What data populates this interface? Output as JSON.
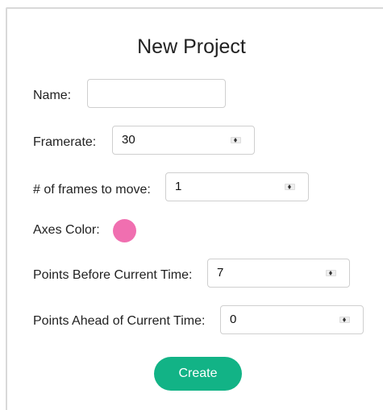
{
  "dialog": {
    "title": "New Project"
  },
  "fields": {
    "name": {
      "label": "Name:",
      "value": ""
    },
    "framerate": {
      "label": "Framerate:",
      "value": "30"
    },
    "frames_to_move": {
      "label": "# of frames to move:",
      "value": "1"
    },
    "axes_color": {
      "label": "Axes Color:",
      "color": "#f06fb0"
    },
    "points_before": {
      "label": "Points Before Current Time:",
      "value": "7"
    },
    "points_ahead": {
      "label": "Points Ahead of Current Time:",
      "value": "0"
    }
  },
  "actions": {
    "create_label": "Create",
    "create_color": "#12b386"
  }
}
